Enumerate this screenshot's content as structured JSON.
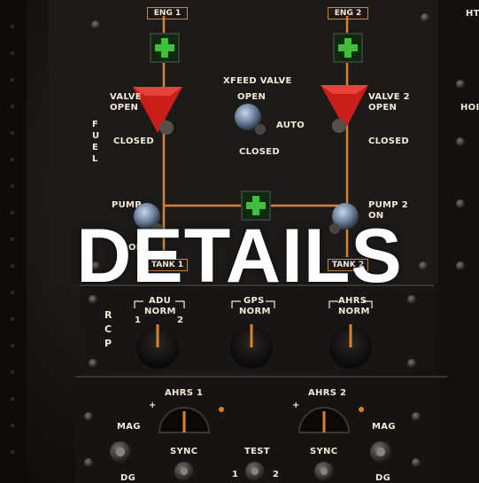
{
  "overlay": {
    "title": "DETAILS"
  },
  "panel": {
    "eng1": "ENG 1",
    "eng2": "ENG 2",
    "ht": "HT",
    "xfeed": "XFEED VALVE",
    "xfeed_open": "OPEN",
    "xfeed_auto": "AUTO",
    "xfeed_closed": "CLOSED",
    "valve1_line1": "VALVE",
    "valve1_line2": "OPEN",
    "valve1_closed": "CLOSED",
    "valve2_line1": "VALVE 2",
    "valve2_line2": "OPEN",
    "valve2_closed": "CLOSED",
    "hois": "HOIS",
    "fuel": "FUEL",
    "pump1": "PUMP",
    "pump2_line1": "PUMP 2",
    "pump2_line2": "ON",
    "tank1": "TANK 1",
    "tank2": "TANK 2",
    "of": "OF",
    "rcp": "RCP",
    "adu": "ADU",
    "adu_norm": "NORM",
    "gps": "GPS",
    "gps_norm": "NORM",
    "ahrs": "AHRS",
    "ahrs_norm": "NORM",
    "sel1": "1",
    "sel2": "2",
    "ahrs1": "AHRS 1",
    "ahrs2": "AHRS 2",
    "mag_l": "MAG",
    "mag_r": "MAG",
    "dg_l": "DG",
    "dg_r": "DG",
    "sync1": "SYNC",
    "sync2": "SYNC",
    "test": "TEST",
    "test1": "1",
    "test2": "2",
    "plus1": "+",
    "plus2": "+"
  },
  "colors": {
    "accent_orange": "#d9822b",
    "indicator_green": "#3fbf3a",
    "valve_red": "#d1231e",
    "legend_text": "#f2e8d6"
  }
}
